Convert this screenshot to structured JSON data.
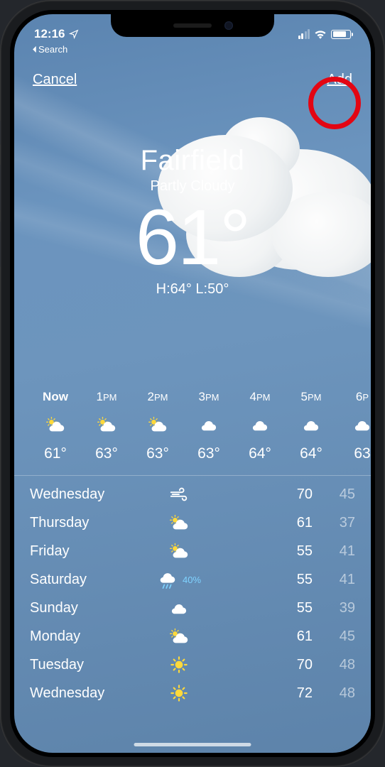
{
  "status_bar": {
    "time": "12:16",
    "back_to_label": "Search"
  },
  "nav": {
    "cancel_label": "Cancel",
    "add_label": "Add"
  },
  "hero": {
    "city": "Fairfield",
    "condition": "Partly Cloudy",
    "temp": "61°",
    "high_low": "H:64°  L:50°"
  },
  "hourly": [
    {
      "label": "Now",
      "ampm": "",
      "icon": "partly-sunny",
      "temp": "61°"
    },
    {
      "label": "1",
      "ampm": "PM",
      "icon": "partly-sunny",
      "temp": "63°"
    },
    {
      "label": "2",
      "ampm": "PM",
      "icon": "partly-sunny",
      "temp": "63°"
    },
    {
      "label": "3",
      "ampm": "PM",
      "icon": "cloud",
      "temp": "63°"
    },
    {
      "label": "4",
      "ampm": "PM",
      "icon": "cloud",
      "temp": "64°"
    },
    {
      "label": "5",
      "ampm": "PM",
      "icon": "cloud",
      "temp": "64°"
    },
    {
      "label": "6",
      "ampm": "P",
      "icon": "cloud",
      "temp": "63"
    }
  ],
  "daily": [
    {
      "day": "Wednesday",
      "icon": "wind",
      "precip": "",
      "high": "70",
      "low": "45"
    },
    {
      "day": "Thursday",
      "icon": "partly-sunny",
      "precip": "",
      "high": "61",
      "low": "37"
    },
    {
      "day": "Friday",
      "icon": "partly-sunny",
      "precip": "",
      "high": "55",
      "low": "41"
    },
    {
      "day": "Saturday",
      "icon": "rain",
      "precip": "40%",
      "high": "55",
      "low": "41"
    },
    {
      "day": "Sunday",
      "icon": "cloud",
      "precip": "",
      "high": "55",
      "low": "39"
    },
    {
      "day": "Monday",
      "icon": "partly-sunny",
      "precip": "",
      "high": "61",
      "low": "45"
    },
    {
      "day": "Tuesday",
      "icon": "sun",
      "precip": "",
      "high": "70",
      "low": "48"
    },
    {
      "day": "Wednesday",
      "icon": "sun",
      "precip": "",
      "high": "72",
      "low": "48"
    }
  ]
}
